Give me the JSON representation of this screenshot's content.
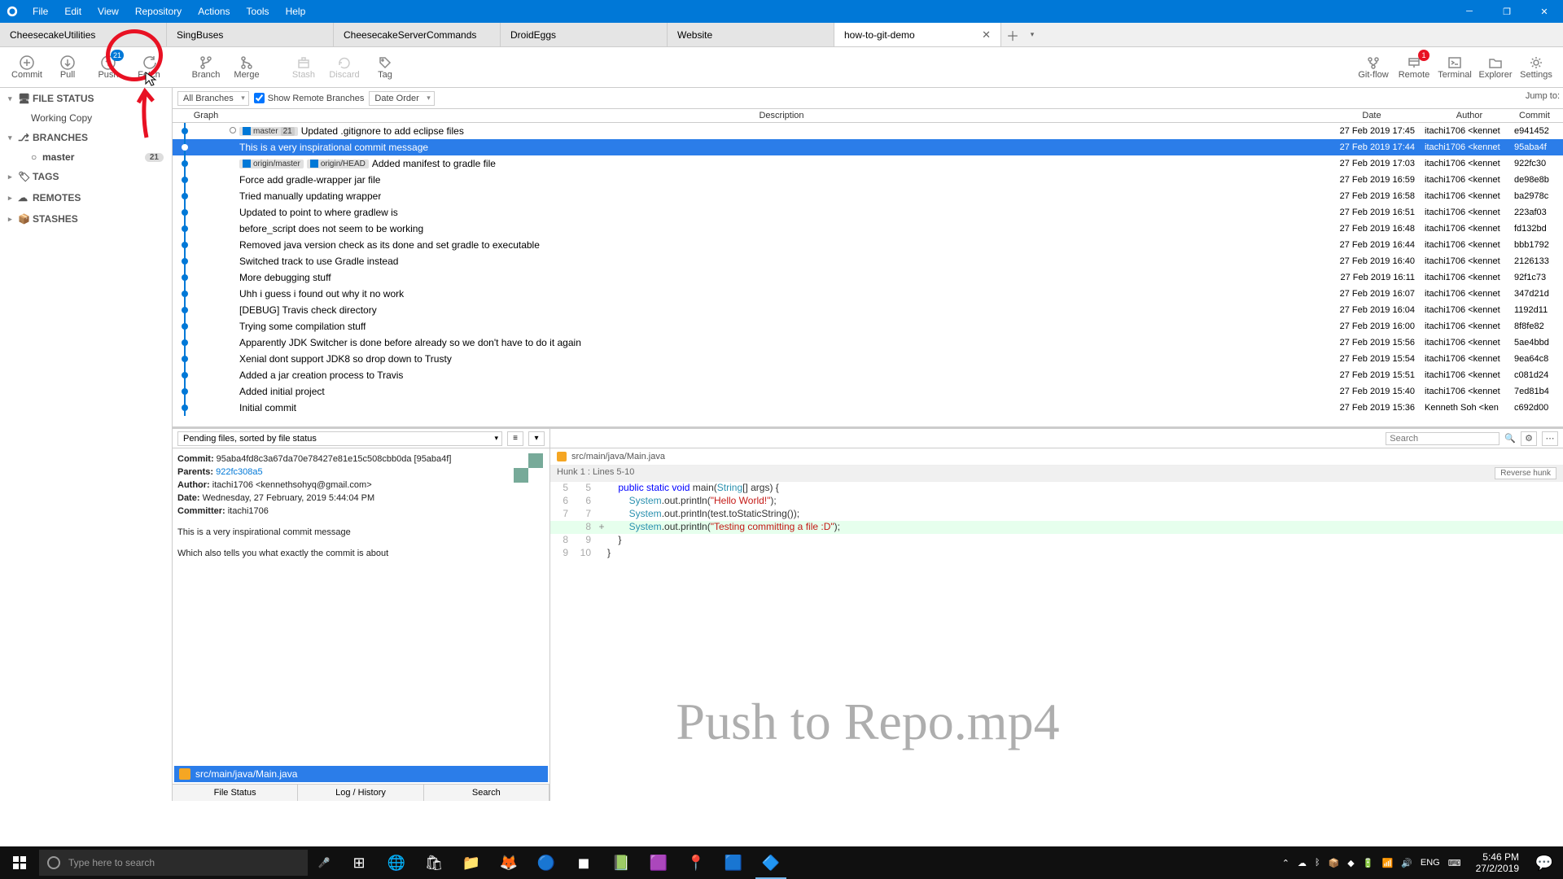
{
  "menu": {
    "items": [
      "File",
      "Edit",
      "View",
      "Repository",
      "Actions",
      "Tools",
      "Help"
    ]
  },
  "tabs": {
    "items": [
      {
        "label": "CheesecakeUtilities",
        "active": false
      },
      {
        "label": "SingBuses",
        "active": false
      },
      {
        "label": "CheesecakeServerCommands",
        "active": false
      },
      {
        "label": "DroidEggs",
        "active": false
      },
      {
        "label": "Website",
        "active": false
      },
      {
        "label": "how-to-git-demo",
        "active": true
      }
    ]
  },
  "toolbar": {
    "commit": "Commit",
    "pull": "Pull",
    "push": "Push",
    "fetch": "Fetch",
    "branch": "Branch",
    "merge": "Merge",
    "stash": "Stash",
    "discard": "Discard",
    "tag": "Tag",
    "gitflow": "Git-flow",
    "remote": "Remote",
    "terminal": "Terminal",
    "explorer": "Explorer",
    "settings": "Settings",
    "push_badge": "21",
    "remote_badge": "1"
  },
  "sidebar": {
    "file_status": "FILE STATUS",
    "working_copy": "Working Copy",
    "branches": "BRANCHES",
    "master": "master",
    "master_count": "21",
    "tags": "TAGS",
    "remotes": "REMOTES",
    "stashes": "STASHES"
  },
  "filters": {
    "branches": "All Branches",
    "remote": "Show Remote Branches",
    "order": "Date Order",
    "jump": "Jump to:"
  },
  "table": {
    "h_graph": "Graph",
    "h_desc": "Description",
    "h_date": "Date",
    "h_auth": "Author",
    "h_commit": "Commit",
    "rows": [
      {
        "msg": "Updated .gitignore to add eclipse files",
        "date": "27 Feb 2019 17:45",
        "auth": "itachi1706 <kennet",
        "commit": "e941452",
        "head": true,
        "pills": [
          {
            "t": "master",
            "c": "21"
          }
        ]
      },
      {
        "msg": "This is a very inspirational commit message",
        "date": "27 Feb 2019 17:44",
        "auth": "itachi1706 <kennet",
        "commit": "95aba4f",
        "selected": true
      },
      {
        "msg": "Added manifest to gradle file",
        "date": "27 Feb 2019 17:03",
        "auth": "itachi1706 <kennet",
        "commit": "922fc30",
        "pills": [
          {
            "t": "origin/master"
          },
          {
            "t": "origin/HEAD"
          }
        ]
      },
      {
        "msg": "Force add gradle-wrapper jar file",
        "date": "27 Feb 2019 16:59",
        "auth": "itachi1706 <kennet",
        "commit": "de98e8b"
      },
      {
        "msg": "Tried manually updating wrapper",
        "date": "27 Feb 2019 16:58",
        "auth": "itachi1706 <kennet",
        "commit": "ba2978c"
      },
      {
        "msg": "Updated to point to where gradlew is",
        "date": "27 Feb 2019 16:51",
        "auth": "itachi1706 <kennet",
        "commit": "223af03"
      },
      {
        "msg": "before_script does not seem to be working",
        "date": "27 Feb 2019 16:48",
        "auth": "itachi1706 <kennet",
        "commit": "fd132bd"
      },
      {
        "msg": "Removed java version check as its done and set gradle to executable",
        "date": "27 Feb 2019 16:44",
        "auth": "itachi1706 <kennet",
        "commit": "bbb1792"
      },
      {
        "msg": "Switched track to use Gradle instead",
        "date": "27 Feb 2019 16:40",
        "auth": "itachi1706 <kennet",
        "commit": "2126133"
      },
      {
        "msg": "More debugging stuff",
        "date": "27 Feb 2019 16:11",
        "auth": "itachi1706 <kennet",
        "commit": "92f1c73"
      },
      {
        "msg": "Uhh i guess i found out why it no work",
        "date": "27 Feb 2019 16:07",
        "auth": "itachi1706 <kennet",
        "commit": "347d21d"
      },
      {
        "msg": "[DEBUG] Travis check directory",
        "date": "27 Feb 2019 16:04",
        "auth": "itachi1706 <kennet",
        "commit": "1192d11"
      },
      {
        "msg": "Trying some compilation stuff",
        "date": "27 Feb 2019 16:00",
        "auth": "itachi1706 <kennet",
        "commit": "8f8fe82"
      },
      {
        "msg": "Apparently JDK Switcher is done before already so we don't have to do it again",
        "date": "27 Feb 2019 15:56",
        "auth": "itachi1706 <kennet",
        "commit": "5ae4bbd"
      },
      {
        "msg": "Xenial dont support JDK8 so drop down to Trusty",
        "date": "27 Feb 2019 15:54",
        "auth": "itachi1706 <kennet",
        "commit": "9ea64c8"
      },
      {
        "msg": "Added a jar creation process to Travis",
        "date": "27 Feb 2019 15:51",
        "auth": "itachi1706 <kennet",
        "commit": "c081d24"
      },
      {
        "msg": "Added initial project",
        "date": "27 Feb 2019 15:40",
        "auth": "itachi1706 <kennet",
        "commit": "7ed81b4"
      },
      {
        "msg": "Initial commit",
        "date": "27 Feb 2019 15:36",
        "auth": "Kenneth Soh <ken",
        "commit": "c692d00"
      }
    ]
  },
  "pending": {
    "label": "Pending files, sorted by file status"
  },
  "meta": {
    "commit_l": "Commit:",
    "commit": "95aba4fd8c3a67da70e78427e81e15c508cbb0da [95aba4f]",
    "parents_l": "Parents:",
    "parents": "922fc308a5",
    "author_l": "Author:",
    "author": "itachi1706 <kennethsohyq@gmail.com>",
    "date_l": "Date:",
    "date": "Wednesday, 27 February, 2019 5:44:04 PM",
    "committer_l": "Committer:",
    "committer": "itachi1706",
    "msg1": "This is a very inspirational commit message",
    "msg2": "Which also tells you what exactly the commit is about"
  },
  "file": {
    "path": "src/main/java/Main.java"
  },
  "btabs": {
    "fs": "File Status",
    "log": "Log / History",
    "search": "Search"
  },
  "diff": {
    "search_ph": "Search",
    "path": "src/main/java/Main.java",
    "hunk": "Hunk 1 : Lines 5-10",
    "reverse": "Reverse hunk",
    "lines": [
      {
        "a": "5",
        "b": "5",
        "s": "",
        "txt": "    public static void main(String[] args) {",
        "cls": ""
      },
      {
        "a": "6",
        "b": "6",
        "s": "",
        "txt": "        System.out.println(\"Hello World!\");",
        "cls": ""
      },
      {
        "a": "7",
        "b": "7",
        "s": "",
        "txt": "        System.out.println(test.toStaticString());",
        "cls": ""
      },
      {
        "a": "",
        "b": "8",
        "s": "+",
        "txt": "        System.out.println(\"Testing committing a file :D\");",
        "cls": "added"
      },
      {
        "a": "8",
        "b": "9",
        "s": "",
        "txt": "    }",
        "cls": ""
      },
      {
        "a": "9",
        "b": "10",
        "s": "",
        "txt": "}",
        "cls": ""
      }
    ]
  },
  "watermark": "Push to Repo.mp4",
  "taskbar": {
    "search_ph": "Type here to search",
    "time": "5:46 PM",
    "date": "27/2/2019",
    "lang": "ENG"
  }
}
